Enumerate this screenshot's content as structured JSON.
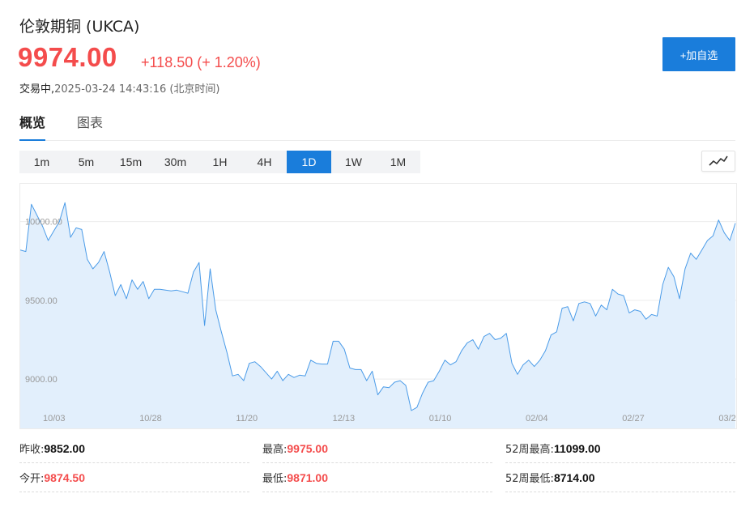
{
  "header": {
    "title": "伦敦期铜 (UKCA)",
    "price": "9974.00",
    "change": "+118.50 (+ 1.20%)",
    "status_label": "交易中,",
    "status_time": "2025-03-24 14:43:16 (北京时间)",
    "add_button": "+加自选"
  },
  "colors": {
    "up": "#f44c4c",
    "accent": "#1a7ddb",
    "line": "#4a9be8",
    "fill": "#e2effc"
  },
  "tabs": [
    {
      "label": "概览",
      "active": true
    },
    {
      "label": "图表",
      "active": false
    }
  ],
  "periods": [
    {
      "label": "1m",
      "active": false
    },
    {
      "label": "5m",
      "active": false
    },
    {
      "label": "15m",
      "active": false
    },
    {
      "label": "30m",
      "active": false
    },
    {
      "label": "1H",
      "active": false
    },
    {
      "label": "4H",
      "active": false
    },
    {
      "label": "1D",
      "active": true
    },
    {
      "label": "1W",
      "active": false
    },
    {
      "label": "1M",
      "active": false
    }
  ],
  "chart_type_icon": "line-chart-icon",
  "chart_data": {
    "type": "area",
    "x_tick_labels": [
      "10/03",
      "10/28",
      "11/20",
      "12/13",
      "01/10",
      "02/04",
      "02/27",
      "03/2"
    ],
    "y_tick_labels": [
      "10000.00",
      "9500.00",
      "9000.00"
    ],
    "y_ticks": [
      10000,
      9500,
      9000
    ],
    "ylim": [
      8800,
      10240
    ],
    "grid": true,
    "values": [
      9820,
      9810,
      10110,
      10040,
      9970,
      9880,
      9940,
      10000,
      10120,
      9900,
      9960,
      9950,
      9760,
      9700,
      9740,
      9810,
      9680,
      9530,
      9600,
      9510,
      9630,
      9570,
      9620,
      9510,
      9570,
      9570,
      9565,
      9560,
      9565,
      9555,
      9545,
      9680,
      9740,
      9340,
      9700,
      9440,
      9300,
      9170,
      9020,
      9030,
      8990,
      9100,
      9110,
      9080,
      9040,
      9000,
      9050,
      8990,
      9030,
      9010,
      9025,
      9020,
      9120,
      9100,
      9095,
      9095,
      9240,
      9240,
      9190,
      9070,
      9060,
      9060,
      8990,
      9050,
      8900,
      8950,
      8945,
      8980,
      8990,
      8960,
      8800,
      8820,
      8910,
      8980,
      8990,
      9050,
      9120,
      9090,
      9110,
      9180,
      9230,
      9250,
      9190,
      9270,
      9290,
      9250,
      9260,
      9290,
      9100,
      9030,
      9090,
      9120,
      9080,
      9120,
      9180,
      9280,
      9300,
      9450,
      9460,
      9370,
      9480,
      9490,
      9480,
      9400,
      9470,
      9440,
      9570,
      9540,
      9530,
      9420,
      9440,
      9430,
      9380,
      9410,
      9400,
      9600,
      9710,
      9650,
      9510,
      9700,
      9800,
      9760,
      9820,
      9880,
      9910,
      10010,
      9930,
      9880,
      9990
    ]
  },
  "stats": [
    [
      {
        "label": "昨收:",
        "value": "9852.00",
        "tone": "dark"
      },
      {
        "label": "最高:",
        "value": "9975.00",
        "tone": "red"
      },
      {
        "label": "52周最高:",
        "value": "11099.00",
        "tone": "dark"
      }
    ],
    [
      {
        "label": "今开:",
        "value": "9874.50",
        "tone": "red"
      },
      {
        "label": "最低:",
        "value": "9871.00",
        "tone": "red"
      },
      {
        "label": "52周最低:",
        "value": "8714.00",
        "tone": "dark"
      }
    ]
  ]
}
